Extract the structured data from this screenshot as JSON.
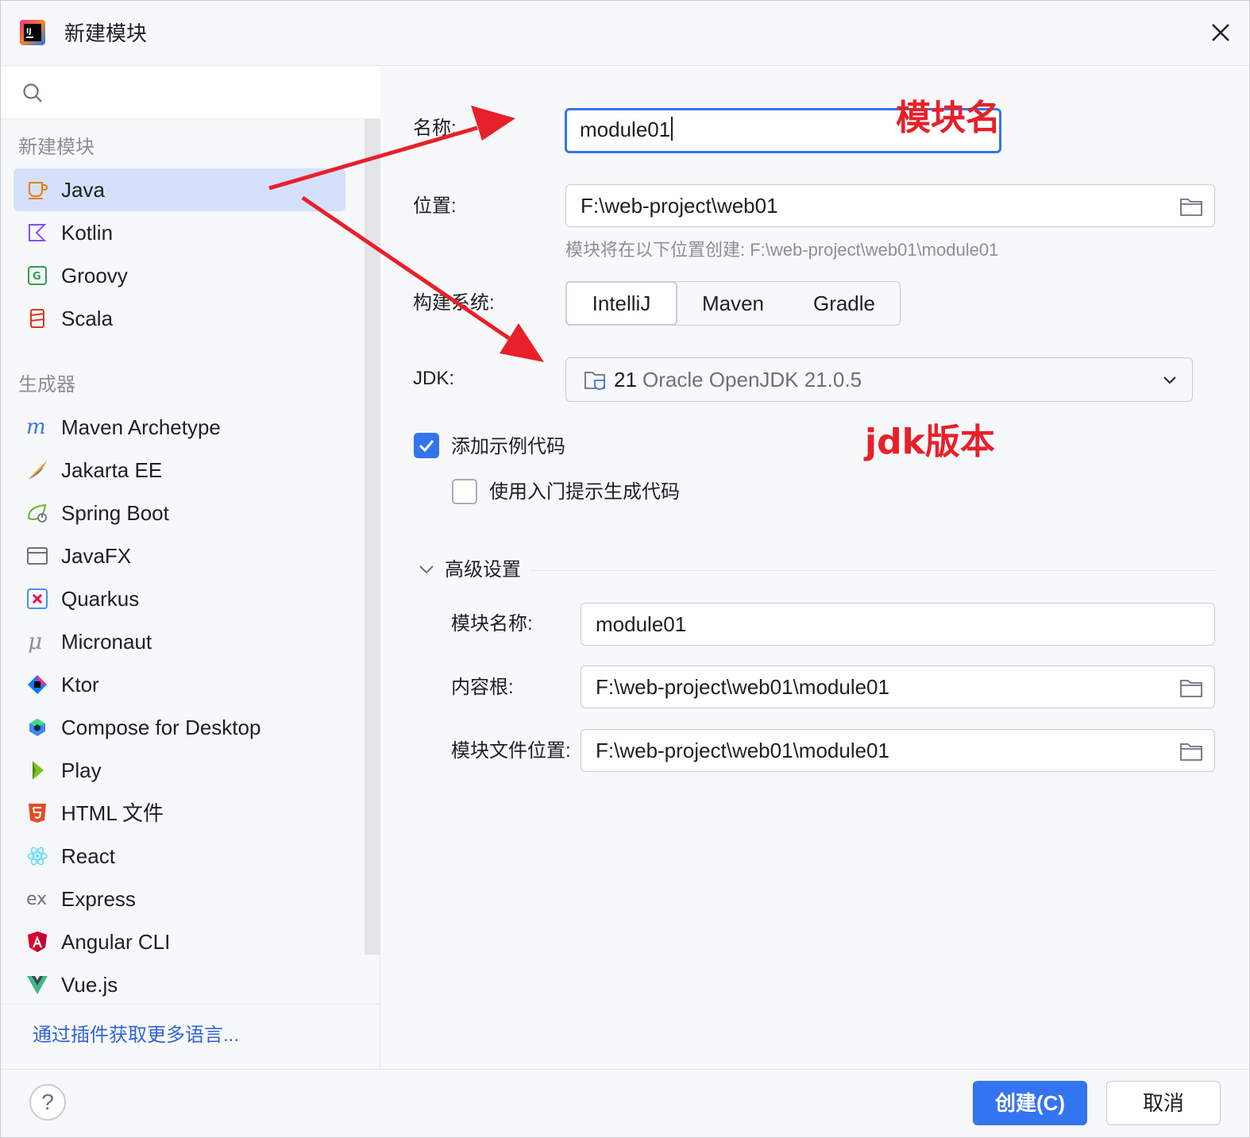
{
  "window": {
    "title": "新建模块"
  },
  "sidebar": {
    "search_placeholder": "",
    "section_new_module": "新建模块",
    "new_module_items": [
      {
        "label": "Java",
        "icon": "java-cup-icon",
        "selected": true
      },
      {
        "label": "Kotlin",
        "icon": "kotlin-icon"
      },
      {
        "label": "Groovy",
        "icon": "groovy-icon"
      },
      {
        "label": "Scala",
        "icon": "scala-icon"
      }
    ],
    "section_generators": "生成器",
    "generator_items": [
      {
        "label": "Maven Archetype",
        "icon": "maven-icon"
      },
      {
        "label": "Jakarta EE",
        "icon": "jakarta-ee-icon"
      },
      {
        "label": "Spring Boot",
        "icon": "spring-boot-icon"
      },
      {
        "label": "JavaFX",
        "icon": "javafx-window-icon"
      },
      {
        "label": "Quarkus",
        "icon": "quarkus-icon"
      },
      {
        "label": "Micronaut",
        "icon": "micronaut-icon"
      },
      {
        "label": "Ktor",
        "icon": "ktor-icon"
      },
      {
        "label": "Compose for Desktop",
        "icon": "compose-icon"
      },
      {
        "label": "Play",
        "icon": "play-icon"
      },
      {
        "label": "HTML 文件",
        "icon": "html5-icon"
      },
      {
        "label": "React",
        "icon": "react-icon"
      },
      {
        "label": "Express",
        "icon": "express-icon"
      },
      {
        "label": "Angular CLI",
        "icon": "angular-icon"
      },
      {
        "label": "Vue.js",
        "icon": "vue-icon"
      }
    ],
    "plugins_link": "通过插件获取更多语言..."
  },
  "form": {
    "name_label": "名称:",
    "name_value": "module01",
    "location_label": "位置:",
    "location_value": "F:\\web-project\\web01",
    "location_hint": "模块将在以下位置创建: F:\\web-project\\web01\\module01",
    "build_system_label": "构建系统:",
    "build_systems": [
      "IntelliJ",
      "Maven",
      "Gradle"
    ],
    "build_system_selected": "IntelliJ",
    "jdk_label": "JDK:",
    "jdk_version": "21",
    "jdk_name": "Oracle OpenJDK 21.0.5",
    "add_sample_code_label": "添加示例代码",
    "add_sample_code_checked": true,
    "onboarding_tips_label": "使用入门提示生成代码",
    "onboarding_tips_checked": false,
    "advanced_label": "高级设置",
    "advanced_expanded": true,
    "module_name_label": "模块名称:",
    "module_name_value": "module01",
    "content_root_label": "内容根:",
    "content_root_value": "F:\\web-project\\web01\\module01",
    "module_file_label": "模块文件位置:",
    "module_file_value": "F:\\web-project\\web01\\module01"
  },
  "annotations": {
    "module_name_note": "模块名",
    "jdk_note": "jdk版本",
    "color": "#e8202a"
  },
  "footer": {
    "help": "?",
    "create_button": "创建(C)",
    "cancel_button": "取消"
  },
  "colors": {
    "accent": "#3574f0",
    "selection": "#d5e1fb",
    "link": "#2f64d6"
  }
}
